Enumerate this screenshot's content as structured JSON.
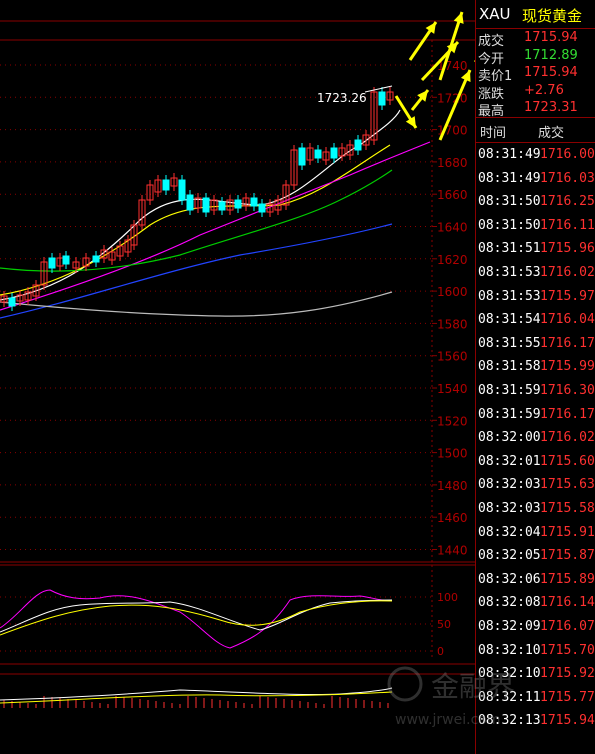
{
  "header": {
    "symbol": "XAU",
    "name": "现货黄金"
  },
  "quote": [
    {
      "label": "成交",
      "value": "1715.94",
      "color": "#ff3030"
    },
    {
      "label": "今开",
      "value": "1712.89",
      "color": "#33dd33"
    },
    {
      "label": "卖价1",
      "value": "1715.94",
      "color": "#ff3030"
    },
    {
      "label": "涨跌",
      "value": "+2.76",
      "color": "#ff3030"
    },
    {
      "label": "最高",
      "value": "1723.31",
      "color": "#ff3030"
    }
  ],
  "tick_table": {
    "header": {
      "time": "时间",
      "price": "成交"
    },
    "rows": [
      {
        "time": "08:31:49",
        "price": "1716.00"
      },
      {
        "time": "08:31:49",
        "price": "1716.03"
      },
      {
        "time": "08:31:50",
        "price": "1716.25"
      },
      {
        "time": "08:31:50",
        "price": "1716.11"
      },
      {
        "time": "08:31:51",
        "price": "1715.96"
      },
      {
        "time": "08:31:53",
        "price": "1716.02"
      },
      {
        "time": "08:31:53",
        "price": "1715.97"
      },
      {
        "time": "08:31:54",
        "price": "1716.04"
      },
      {
        "time": "08:31:55",
        "price": "1716.17"
      },
      {
        "time": "08:31:58",
        "price": "1715.99"
      },
      {
        "time": "08:31:59",
        "price": "1716.30"
      },
      {
        "time": "08:31:59",
        "price": "1716.17"
      },
      {
        "time": "08:32:00",
        "price": "1716.02"
      },
      {
        "time": "08:32:01",
        "price": "1715.60"
      },
      {
        "time": "08:32:03",
        "price": "1715.63"
      },
      {
        "time": "08:32:03",
        "price": "1715.58"
      },
      {
        "time": "08:32:04",
        "price": "1715.91"
      },
      {
        "time": "08:32:05",
        "price": "1715.87"
      },
      {
        "time": "08:32:06",
        "price": "1715.89"
      },
      {
        "time": "08:32:08",
        "price": "1716.14"
      },
      {
        "time": "08:32:09",
        "price": "1716.07"
      },
      {
        "time": "08:32:10",
        "price": "1715.70"
      },
      {
        "time": "08:32:10",
        "price": "1715.92"
      },
      {
        "time": "08:32:11",
        "price": "1715.77"
      },
      {
        "time": "08:32:13",
        "price": "1715.94"
      }
    ]
  },
  "price_axis": {
    "labels": [
      "1740",
      "1720",
      "1700",
      "1680",
      "1660",
      "1640",
      "1620",
      "1600",
      "1580",
      "1560",
      "1540",
      "1520",
      "1500",
      "1480",
      "1460",
      "1440"
    ],
    "min": 1430,
    "max": 1745
  },
  "high_label": "1723.26",
  "osc_axis": {
    "labels": [
      "100",
      "50",
      "0"
    ]
  },
  "watermark": {
    "brand": "金融界",
    "url": "www.jrwei.com"
  },
  "colors": {
    "up": "#ff3030",
    "down": "#00ffff",
    "grid": "#8a0000",
    "annotation": "#ffff00"
  }
}
